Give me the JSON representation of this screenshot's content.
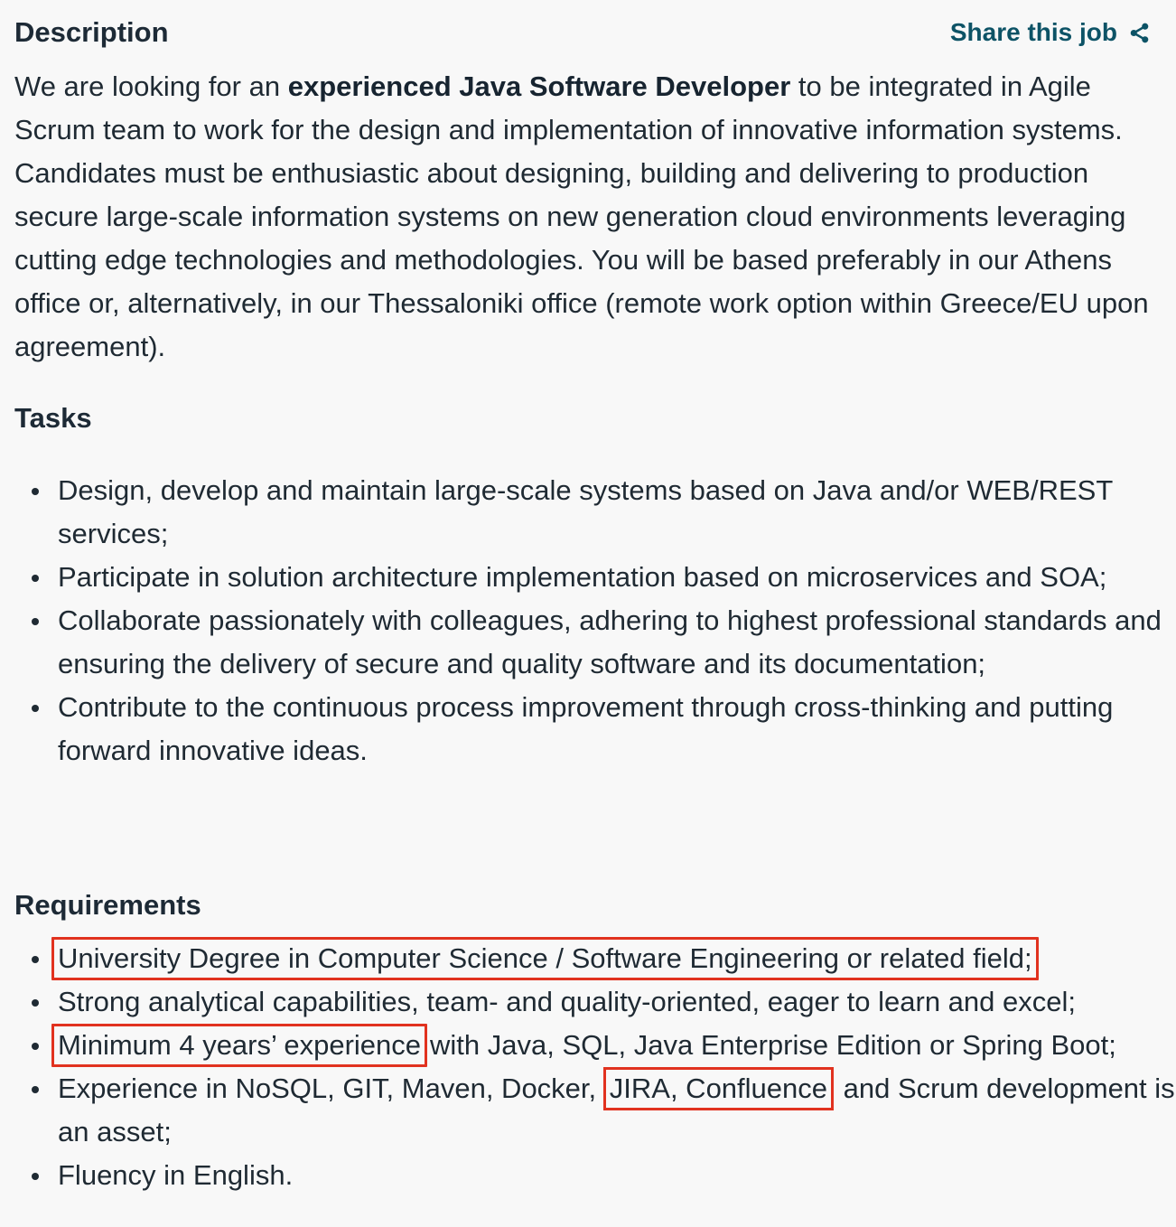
{
  "header": {
    "title": "Description",
    "share_label": "Share this job",
    "share_icon": "share-icon",
    "share_color": "#0d5366"
  },
  "description": {
    "text_before": "We are looking for an ",
    "bold": "experienced Java Software Developer",
    "text_after": " to be integrated in Agile Scrum team to work for the design and implementation of innovative information systems. Candidates must be enthusiastic about designing, building and delivering to production secure large-scale information systems on new generation cloud environments leveraging cutting edge technologies and methodologies. You will be based preferably in our Athens office or, alternatively, in our Thessaloniki office (remote work option within Greece/EU upon agreement)."
  },
  "tasks": {
    "title": "Tasks",
    "items": [
      "Design, develop and maintain large-scale systems based on Java and/or WEB/REST services;",
      "Participate in solution architecture implementation based on microservices and SOA;",
      "Collaborate passionately with colleagues, adhering to highest professional standards and ensuring the delivery of secure and quality software and its documentation;",
      "Contribute to the continuous process improvement through cross-thinking and putting forward innovative ideas."
    ]
  },
  "requirements": {
    "title": "Requirements",
    "highlight_color": "#e1321f",
    "item1": "University Degree in Computer Science / Software Engineering or related field;",
    "item2": "Strong analytical capabilities, team- and quality-oriented, eager to learn and excel;",
    "item3_highlight": "Minimum 4 years’ experience",
    "item3_rest": "with Java, SQL, Java Enterprise Edition or Spring Boot;",
    "item4_before": "Experience in NoSQL, GIT, Maven, Docker,",
    "item4_highlight": "JIRA, Confluence",
    "item4_after": "and Scrum development is an asset;",
    "item5": "Fluency in English."
  }
}
